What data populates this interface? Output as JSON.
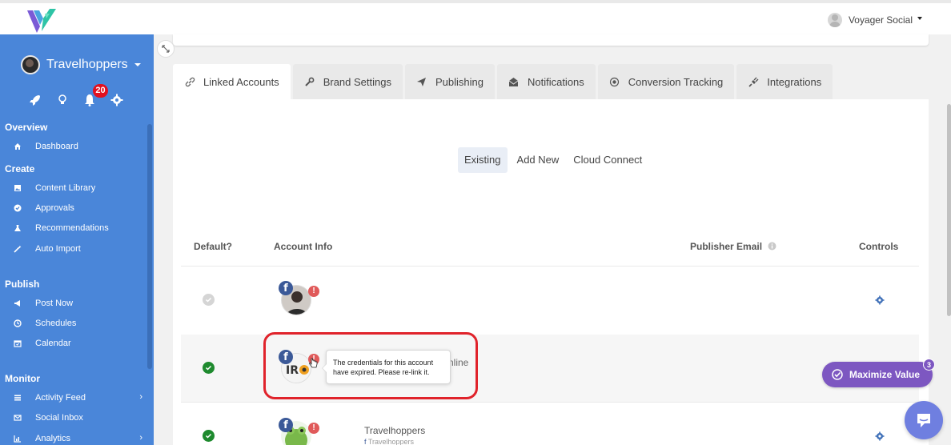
{
  "header": {
    "user_name": "Voyager Social"
  },
  "sidebar": {
    "brand_name": "Travelhoppers",
    "notification_count": "20",
    "sections": [
      {
        "title": "Overview",
        "items": [
          {
            "label": "Dashboard",
            "icon": "home-icon"
          }
        ]
      },
      {
        "title": "Create",
        "items": [
          {
            "label": "Content Library",
            "icon": "image-icon"
          },
          {
            "label": "Approvals",
            "icon": "check-circle-icon"
          },
          {
            "label": "Recommendations",
            "icon": "flask-icon"
          },
          {
            "label": "Auto Import",
            "icon": "magic-wand-icon"
          }
        ]
      },
      {
        "title": "Publish",
        "items": [
          {
            "label": "Post Now",
            "icon": "bullhorn-icon"
          },
          {
            "label": "Schedules",
            "icon": "clock-icon"
          },
          {
            "label": "Calendar",
            "icon": "calendar-icon"
          }
        ]
      },
      {
        "title": "Monitor",
        "items": [
          {
            "label": "Activity Feed",
            "icon": "list-icon"
          },
          {
            "label": "Social Inbox",
            "icon": "envelope-icon"
          },
          {
            "label": "Analytics",
            "icon": "bar-chart-icon"
          }
        ]
      }
    ]
  },
  "tabs": [
    {
      "label": "Linked Accounts",
      "icon": "link-icon",
      "active": true
    },
    {
      "label": "Brand Settings",
      "icon": "wrench-icon"
    },
    {
      "label": "Publishing",
      "icon": "paper-plane-icon"
    },
    {
      "label": "Notifications",
      "icon": "envelope-open-icon"
    },
    {
      "label": "Conversion Tracking",
      "icon": "target-icon"
    },
    {
      "label": "Integrations",
      "icon": "plug-icon"
    }
  ],
  "subtabs": [
    {
      "label": "Existing",
      "active": true
    },
    {
      "label": "Add New"
    },
    {
      "label": "Cloud Connect"
    }
  ],
  "table": {
    "headers": {
      "default": "Default?",
      "account_info": "Account Info",
      "publisher_email": "Publisher Email",
      "controls": "Controls"
    },
    "rows": [
      {
        "default_state": "inactive"
      },
      {
        "default_state": "active",
        "name_partial": "nline"
      },
      {
        "default_state": "active",
        "name": "Travelhoppers",
        "sub": "Travelhoppers"
      }
    ]
  },
  "tooltip": {
    "text": "The credentials for this account have expired. Please re-link it."
  },
  "maximize": {
    "label": "Maximize Value",
    "badge": "3"
  },
  "colors": {
    "sidebar": "#4a86d9",
    "facebook": "#3b5998",
    "success": "#1e8a2e",
    "warning": "#e05a5a",
    "highlight": "#e0232b",
    "maximize": "#7d57c1"
  }
}
